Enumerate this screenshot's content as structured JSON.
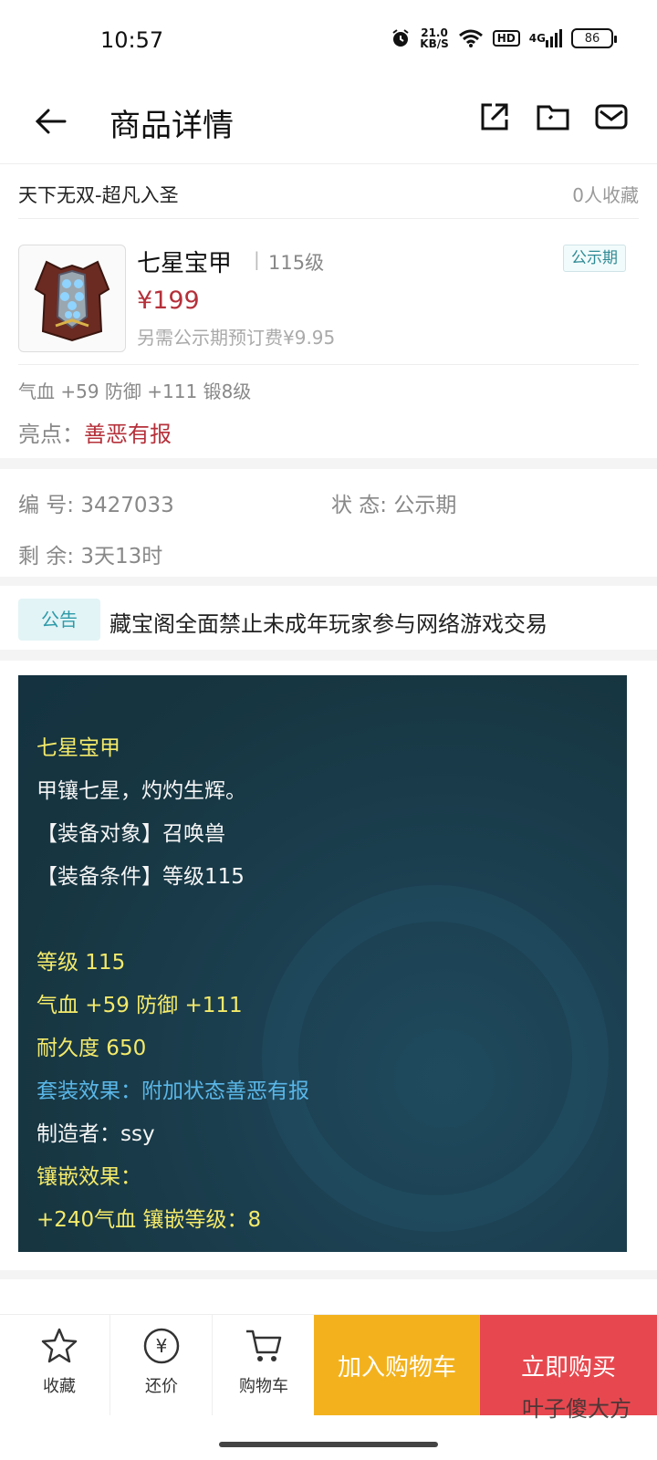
{
  "status_bar": {
    "time": "10:57",
    "net_speed_value": "21.0",
    "net_speed_unit": "KB/S",
    "hd": "HD",
    "signal": "4G",
    "battery": "86"
  },
  "header": {
    "title": "商品详情",
    "icons": [
      "back-arrow-icon",
      "share-icon",
      "folder-icon",
      "mail-icon"
    ]
  },
  "product": {
    "shop_name": "天下无双-超凡入圣",
    "favorites": "0人收藏",
    "name": "七星宝甲",
    "separator": "|",
    "level": "115级",
    "price": "¥199",
    "fee": "另需公示期预订费¥9.95",
    "badge": "公示期",
    "stats": "气血 +59 防御 +111 锻8级",
    "highlight_label": "亮点：",
    "highlight_value": "善恶有报"
  },
  "info": {
    "number_label": "编  号:",
    "number_value": "3427033",
    "status_label": "状  态:",
    "status_value": "公示期",
    "remain_label": "剩  余:",
    "remain_value": "3天13时"
  },
  "notice": {
    "tag": "公告",
    "text": "藏宝阁全面禁止未成年玩家参与网络游戏交易"
  },
  "item_panel": {
    "name": "七星宝甲",
    "desc": "甲镶七星，灼灼生辉。",
    "target": "【装备对象】召唤兽",
    "condition": "【装备条件】等级115",
    "level": "等级 115",
    "stats": "气血 +59 防御 +111",
    "durability": "耐久度 650",
    "set_effect": "套装效果：附加状态善恶有报",
    "maker": "制造者：ssy",
    "inlay_title": "镶嵌效果：",
    "inlay_value": "+240气血 镶嵌等级：8"
  },
  "bottom_bar": {
    "favorite": "收藏",
    "bargain": "还价",
    "cart": "购物车",
    "add_cart": "加入购物车",
    "buy_now": "立即购买",
    "bargain_symbol": "¥"
  },
  "watermark": "叶子傻大方",
  "colors": {
    "price_red": "#b5303a",
    "cart_yellow": "#f3b21d",
    "buy_red": "#e7484f",
    "teal": "#2d9aa8",
    "panel_bg": "#1b3e4e"
  }
}
